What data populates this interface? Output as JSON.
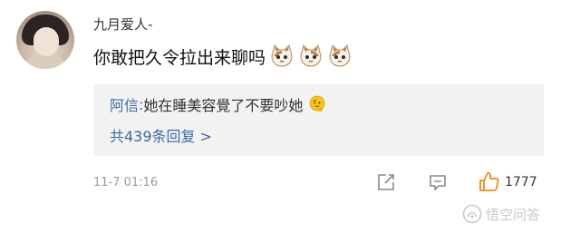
{
  "comment": {
    "username": "九月爱人-",
    "text": "你敢把久令拉出来聊吗",
    "emoji_icons": [
      "cat-face-icon",
      "cat-face-icon",
      "cat-face-icon"
    ]
  },
  "reply": {
    "author": "阿信",
    "separator": ": ",
    "text": "她在睡美容覺了不要吵她",
    "emoji_icon": "thinking-face-icon",
    "more_link": "共439条回复 >"
  },
  "footer": {
    "timestamp": "11-7 01:16",
    "actions": [
      "share-icon",
      "comment-icon",
      "like-icon"
    ],
    "like_count": "1777"
  },
  "watermark": {
    "text": "悟空问答"
  },
  "colors": {
    "link_blue": "#3c6aa6",
    "like_orange": "#f08a1c",
    "meta_gray": "#9b9b9b",
    "reply_bg": "#f2f2f2"
  }
}
